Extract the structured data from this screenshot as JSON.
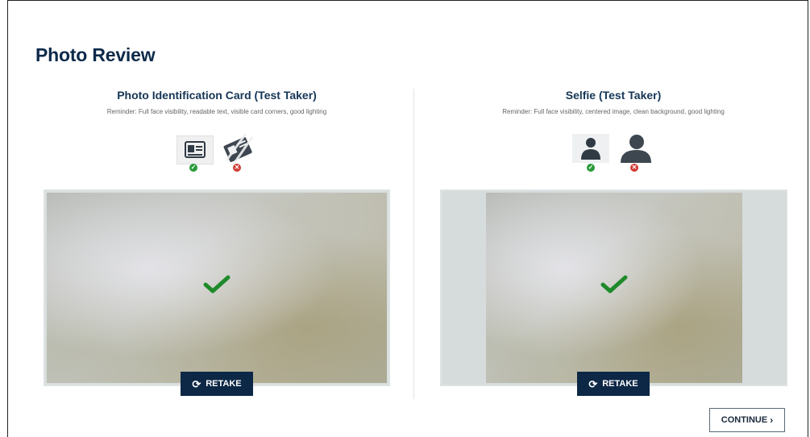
{
  "page": {
    "title": "Photo Review"
  },
  "id_card": {
    "title": "Photo Identification Card (Test Taker)",
    "hint": "Reminder: Full face visibility, readable text, visible card corners, good lighting",
    "icons": [
      "id-card-good-example-icon",
      "id-card-bad-example-icon"
    ],
    "status_icon": "check-icon",
    "retake_label": "RETAKE"
  },
  "selfie": {
    "title": "Selfie (Test Taker)",
    "hint": "Reminder: Full face visibility, centered image, clean background, good lighting",
    "icons": [
      "selfie-good-example-icon",
      "selfie-bad-example-icon"
    ],
    "status_icon": "check-icon",
    "retake_label": "RETAKE"
  },
  "footer": {
    "continue_label": "CONTINUE",
    "continue_icon": "chevron-right-icon"
  },
  "colors": {
    "title": "#0d2a4a",
    "retake_bg": "#0d2746",
    "ok_badge": "#2a9a3a",
    "bad_badge": "#d23a32",
    "check": "#1e8a2a"
  }
}
